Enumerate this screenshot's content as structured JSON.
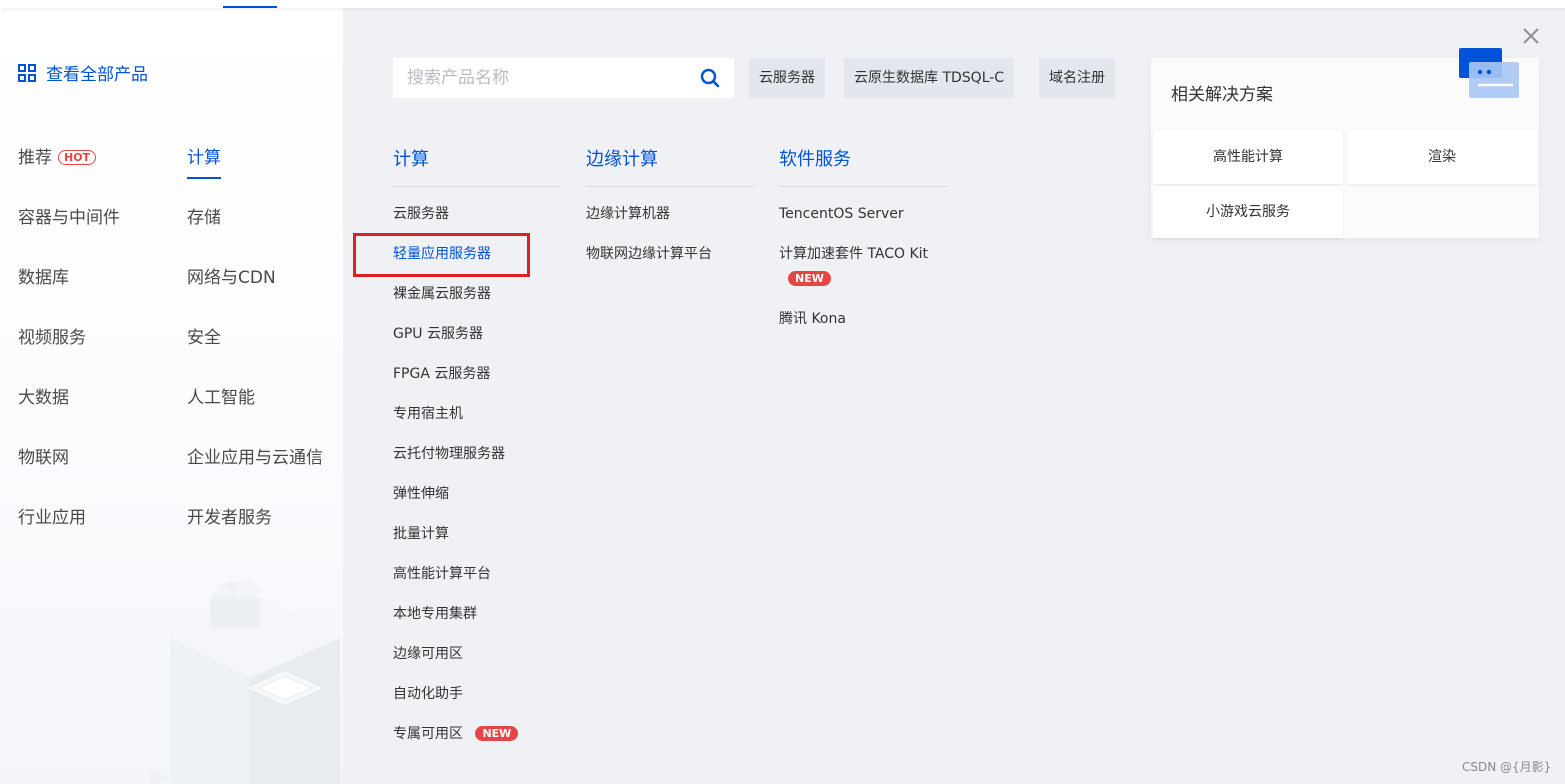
{
  "sidebar": {
    "all_products": "查看全部产品",
    "hot_badge": "HOT",
    "categories": [
      {
        "label": "推荐"
      },
      {
        "label": "计算"
      },
      {
        "label": "容器与中间件"
      },
      {
        "label": "存储"
      },
      {
        "label": "数据库"
      },
      {
        "label": "网络与CDN"
      },
      {
        "label": "视频服务"
      },
      {
        "label": "安全"
      },
      {
        "label": "大数据"
      },
      {
        "label": "人工智能"
      },
      {
        "label": "物联网"
      },
      {
        "label": "企业应用与云通信"
      },
      {
        "label": "行业应用"
      },
      {
        "label": "开发者服务"
      }
    ],
    "active": "计算"
  },
  "search": {
    "placeholder": "搜索产品名称",
    "value": "",
    "quick_tags": [
      "云服务器",
      "云原生数据库 TDSQL-C",
      "域名注册"
    ]
  },
  "columns": [
    {
      "title": "计算",
      "items": [
        {
          "label": "云服务器"
        },
        {
          "label": "轻量应用服务器",
          "selected": true
        },
        {
          "label": "裸金属云服务器"
        },
        {
          "label": "GPU 云服务器"
        },
        {
          "label": "FPGA 云服务器"
        },
        {
          "label": "专用宿主机"
        },
        {
          "label": "云托付物理服务器"
        },
        {
          "label": "弹性伸缩"
        },
        {
          "label": "批量计算"
        },
        {
          "label": "高性能计算平台"
        },
        {
          "label": "本地专用集群"
        },
        {
          "label": "边缘可用区"
        },
        {
          "label": "自动化助手"
        },
        {
          "label": "专属可用区",
          "badge": "NEW"
        }
      ]
    },
    {
      "title": "边缘计算",
      "items": [
        {
          "label": "边缘计算机器"
        },
        {
          "label": "物联网边缘计算平台"
        }
      ]
    },
    {
      "title": "软件服务",
      "items": [
        {
          "label": "TencentOS Server"
        },
        {
          "label": "计算加速套件 TACO Kit",
          "badge": "NEW"
        },
        {
          "label": "腾讯 Kona"
        }
      ]
    }
  ],
  "solutions": {
    "title": "相关解决方案",
    "items": [
      "高性能计算",
      "渲染",
      "小游戏云服务"
    ]
  },
  "watermark": "CSDN @{月影}",
  "colors": {
    "accent": "#0052d9",
    "badge_red": "#e54545",
    "highlight_red": "#e02020",
    "panel_bg": "#f0f1f5"
  }
}
